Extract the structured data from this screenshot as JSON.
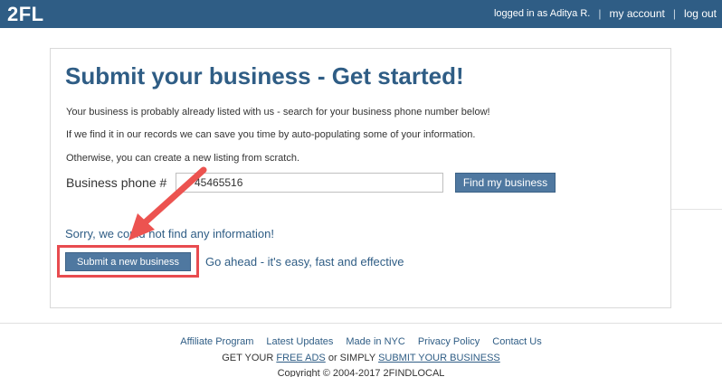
{
  "header": {
    "logo": "2FL",
    "logged_in_text": "logged in as Aditya R.",
    "separator": "|",
    "my_account": "my account",
    "log_out": "log out",
    "bar_color": "#2f5d85"
  },
  "main": {
    "title": "Submit your business - Get started!",
    "intro_1": "Your business is probably already listed with us - search for your business phone number below!",
    "intro_2": "If we find it in our records we can save you time by auto-populating some of your information.",
    "intro_3": "Otherwise, you can create a new listing from scratch.",
    "phone_label": "Business phone #",
    "phone_value": "45465516",
    "find_button": "Find my business",
    "sorry_message": "Sorry, we could not find any information!",
    "submit_button": "Submit a new business",
    "go_ahead": "Go ahead - it's easy, fast and effective",
    "highlight_color": "#e84b4f"
  },
  "footer": {
    "links": [
      "Affiliate Program",
      "Latest Updates",
      "Made in NYC",
      "Privacy Policy",
      "Contact Us"
    ],
    "ads_prefix": "GET YOUR",
    "free_ads": "FREE ADS",
    "ads_middle": "or SIMPLY",
    "submit_business": "SUBMIT YOUR BUSINESS",
    "copyright": "Copyright © 2004-2017 2FINDLOCAL"
  }
}
